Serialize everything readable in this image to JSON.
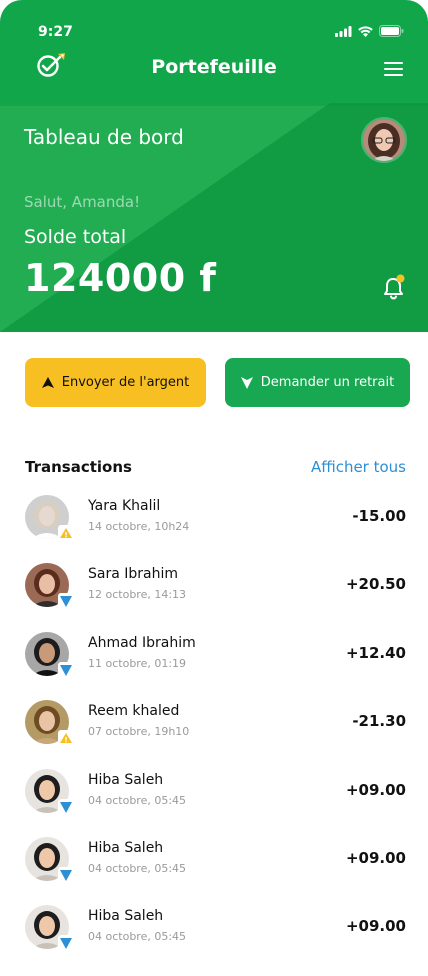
{
  "status": {
    "time": "9:27"
  },
  "header": {
    "title": "Portefeuille"
  },
  "dashboard": {
    "title": "Tableau de bord",
    "greeting": "Salut, Amanda!",
    "balance_label": "Solde total",
    "balance_value": "124000 f"
  },
  "actions": {
    "send_label": "Envoyer de l'argent",
    "withdraw_label": "Demander un retrait"
  },
  "transactions": {
    "title": "Transactions",
    "view_all": "Afficher tous",
    "items": [
      {
        "name": "Yara Khalil",
        "date": "14 octobre, 10h24",
        "amount": "-15.00",
        "direction": "sent"
      },
      {
        "name": "Sara Ibrahim",
        "date": "12 octobre, 14:13",
        "amount": "+20.50",
        "direction": "received"
      },
      {
        "name": "Ahmad Ibrahim",
        "date": "11 octobre, 01:19",
        "amount": "+12.40",
        "direction": "received"
      },
      {
        "name": "Reem khaled",
        "date": "07 octobre, 19h10",
        "amount": "-21.30",
        "direction": "sent"
      },
      {
        "name": "Hiba Saleh",
        "date": "04 octobre, 05:45",
        "amount": "+09.00",
        "direction": "received"
      },
      {
        "name": "Hiba Saleh",
        "date": "04 octobre, 05:45",
        "amount": "+09.00",
        "direction": "received"
      },
      {
        "name": "Hiba Saleh",
        "date": "04 octobre, 05:45",
        "amount": "+09.00",
        "direction": "received"
      }
    ]
  },
  "colors": {
    "primary_green": "#1faa4f",
    "accent_yellow": "#f8bf22",
    "link_blue": "#2d8fd6",
    "received_badge": "#2d8fd6",
    "sent_badge": "#f8bf22"
  },
  "icons": {
    "logo": "rocket-check-icon",
    "menu": "hamburger-menu-icon",
    "notification": "bell-icon",
    "send": "arrow-up-icon",
    "withdraw": "arrow-down-icon"
  }
}
